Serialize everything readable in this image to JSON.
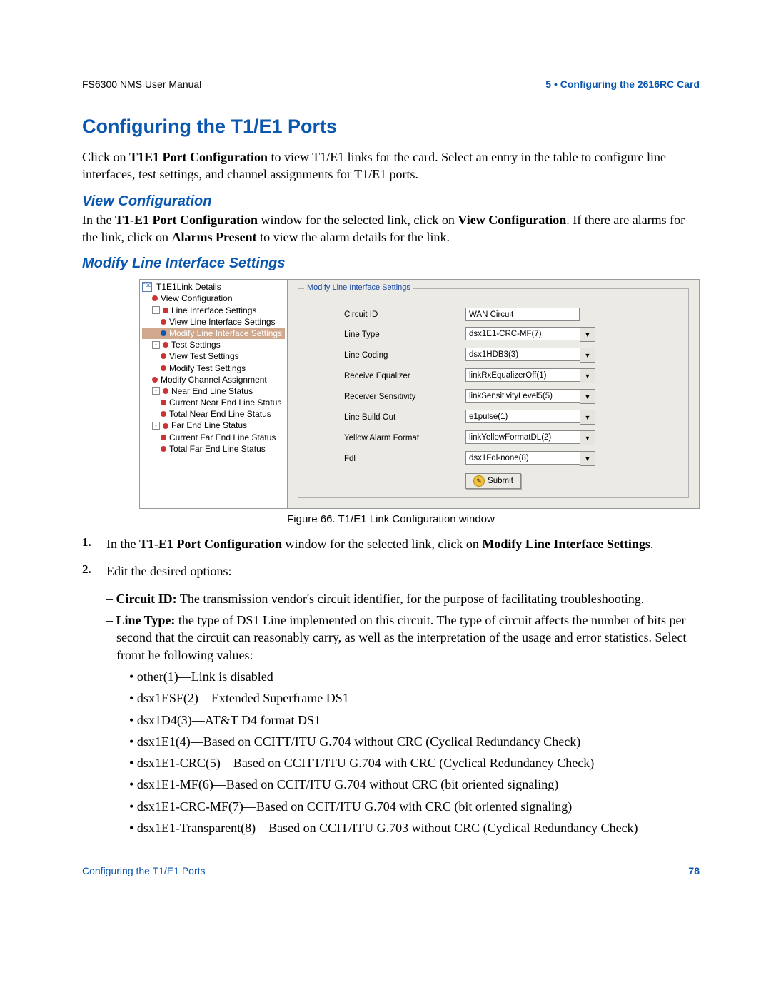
{
  "header": {
    "left": "FS6300 NMS User Manual",
    "right": "5 • Configuring the 2616RC Card"
  },
  "section_title": "Configuring the T1/E1 Ports",
  "intro": {
    "pre": "Click on ",
    "bold": "T1E1 Port Configuration",
    "post": " to view T1/E1 links for the card. Select an entry in the table to configure line interfaces, test settings, and channel assignments for T1/E1 ports."
  },
  "view_cfg": {
    "title": "View Configuration",
    "pre1": "In the ",
    "b1": "T1-E1 Port Configuration",
    "mid": " window for the selected link, click on ",
    "b2": "View Configuration",
    "post": ". If there are alarms for the link, click on ",
    "b3": "Alarms Present",
    "post2": " to view the alarm details for the link."
  },
  "mlis_title": "Modify Line Interface Settings",
  "tree": {
    "root": "T1E1Link Details",
    "items": [
      "View Configuration",
      "Line Interface Settings",
      "View Line Interface Settings",
      "Modify Line Interface Settings",
      "Test Settings",
      "View Test Settings",
      "Modify Test Settings",
      "Modify Channel Assignment",
      "Near End Line Status",
      "Current Near End Line Status",
      "Total Near End Line Status",
      "Far End Line Status",
      "Current Far End Line Status",
      "Total Far End Line Status"
    ]
  },
  "form": {
    "legend": "Modify Line Interface Settings",
    "rows": [
      {
        "label": "Circuit ID",
        "value": "WAN Circuit",
        "type": "text"
      },
      {
        "label": "Line Type",
        "value": "dsx1E1-CRC-MF(7)",
        "type": "select"
      },
      {
        "label": "Line Coding",
        "value": "dsx1HDB3(3)",
        "type": "select"
      },
      {
        "label": "Receive Equalizer",
        "value": "linkRxEqualizerOff(1)",
        "type": "select"
      },
      {
        "label": "Receiver Sensitivity",
        "value": "linkSensitivityLevel5(5)",
        "type": "select"
      },
      {
        "label": "Line Build Out",
        "value": "e1pulse(1)",
        "type": "select"
      },
      {
        "label": "Yellow Alarm Format",
        "value": "linkYellowFormatDL(2)",
        "type": "select"
      },
      {
        "label": "Fdl",
        "value": "dsx1Fdl-none(8)",
        "type": "select"
      }
    ],
    "submit": "Submit"
  },
  "fig_caption": "Figure 66. T1/E1 Link Configuration window",
  "step1": {
    "pre": "In the ",
    "b1": "T1-E1 Port Configuration",
    "mid": " window for the selected link, click on ",
    "b2": "Modify Line Interface Settings",
    "post": "."
  },
  "step2": "Edit the desired options:",
  "bullets": {
    "circuit": {
      "b": "Circuit ID:",
      "t": " The transmission vendor's circuit identifier, for the purpose of facilitating troubleshooting."
    },
    "linetype": {
      "b": "Line Type:",
      "t": " the type of DS1 Line implemented on this circuit. The type of circuit affects the number of bits per second that the circuit can reasonably carry, as well as the interpretation of the usage and error statistics. Select fromt he following values:"
    },
    "vals": [
      "other(1)—Link is disabled",
      "dsx1ESF(2)—Extended Superframe DS1",
      "dsx1D4(3)—AT&T D4 format DS1",
      "dsx1E1(4)—Based on CCITT/ITU G.704 without CRC (Cyclical Redundancy Check)",
      "dsx1E1-CRC(5)—Based on CCITT/ITU G.704 with CRC (Cyclical Redundancy Check)",
      "dsx1E1-MF(6)—Based on CCIT/ITU G.704 without CRC (bit oriented signaling)",
      "dsx1E1-CRC-MF(7)—Based on CCIT/ITU G.704 with CRC (bit oriented signaling)",
      "dsx1E1-Transparent(8)—Based on CCIT/ITU G.703 without CRC (Cyclical Redundancy Check)"
    ]
  },
  "footer": {
    "left": "Configuring the T1/E1 Ports",
    "right": "78"
  }
}
